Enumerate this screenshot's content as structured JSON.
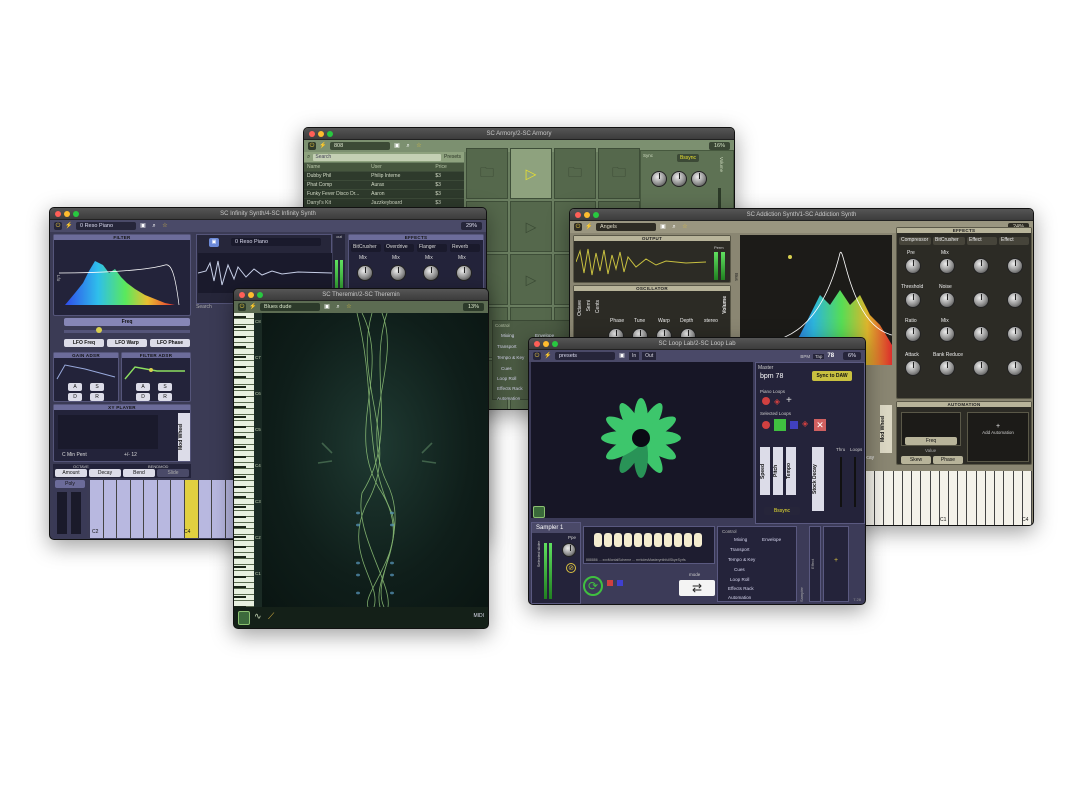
{
  "armory": {
    "title": "SC Armory/2-SC Armory",
    "preset": "808",
    "search_placeholder": "Search",
    "presets_label": "Presets",
    "percent": "16%",
    "columns": [
      "Name",
      "User",
      "Price"
    ],
    "rows": [
      {
        "name": "Dubby Phil",
        "user": "Philip Interne",
        "price": "$3"
      },
      {
        "name": "Phat Comp",
        "user": "Aurax",
        "price": "$3"
      },
      {
        "name": "Funky Fever Disco Dr...",
        "user": "Aaron",
        "price": "$3"
      },
      {
        "name": "Darryl's Kit",
        "user": "Jazzkeyboard",
        "price": "$3"
      }
    ],
    "menu_header": "Control",
    "menu": [
      "Mixing",
      "Envelope",
      "Transport",
      "Tempo & Key",
      "Cues",
      "Loop Roll",
      "Effects Rack",
      "Automation"
    ],
    "sync_label": "Bssync",
    "side_labels": [
      "Sync",
      "Volume",
      "Mode"
    ]
  },
  "infinity": {
    "title": "SC Infinity Synth/4-SC Infinity Synth",
    "preset": "0 Reso Piano",
    "preset2": "0 Reso Piano",
    "percent": "29%",
    "filter_label": "FILTER",
    "freq_label": "Freq",
    "lfo_buttons": [
      "LFO Freq",
      "LFO Warp",
      "LFO Phase"
    ],
    "gain_label": "GAIN ADSR",
    "filter_adsr_label": "FILTER ADSR",
    "adsr": [
      "A",
      "S",
      "D",
      "R"
    ],
    "xy_label": "XY PLAYER",
    "min_pent": "C Min Pent",
    "range": "+/- 12",
    "mod_wheel": "Mod Wheel",
    "effects_label": "EFFECTS",
    "effects": [
      "BitCrusher",
      "Overdrive",
      "Flanger",
      "Reverb"
    ],
    "mix": "Mix",
    "out": "out",
    "octave_label": "OCTAVE",
    "bendmod_label": "BENDMOD",
    "bottom_buttons": [
      "Amount",
      "Decay",
      "Bend",
      "Slide"
    ],
    "poly": "Poly",
    "key_labels": [
      "C2",
      "C3",
      "C4"
    ],
    "search": "Search",
    "side_label": "Lfo",
    "volume": "Volume"
  },
  "addiction": {
    "title": "SC Addiction Synth/1-SC Addiction Synth",
    "preset": "Angels",
    "percent": "24%",
    "output_label": "OUTPUT",
    "dots_label": "Perm",
    "oscillator_label": "OSCILLATOR",
    "osc_labels": [
      "Octave",
      "Semi",
      "Cents"
    ],
    "osc_knobs": [
      "Phase",
      "Tune",
      "Warp",
      "Depth"
    ],
    "stereo": "stereo",
    "volume": "Volume",
    "effects_label": "EFFECTS",
    "effect_slots": [
      "Compressor",
      "BitCrusher",
      "Effect",
      "Effect"
    ],
    "effect_knobs": [
      "Pre",
      "Mix",
      "Threshold",
      "Noise",
      "Ratio",
      "Mix",
      "Attack",
      "Bank Reduce"
    ],
    "automation_label": "AUTOMATION",
    "freq": "Freq",
    "value": "Value",
    "add_automation": "Add Automation",
    "skew": "Skew",
    "phase": "Phase",
    "mod_wheel": "Mod Wheel",
    "decay": "Decay",
    "key_labels": [
      "C1",
      "C3",
      "C4"
    ],
    "side_label": "Bus"
  },
  "theremin": {
    "title": "SC Theremin/2-SC Theremin",
    "preset": "Blues dude",
    "percent": "13%",
    "key_labels": [
      "C8",
      "C7",
      "C6",
      "C5",
      "C4",
      "C3",
      "C2",
      "C1"
    ],
    "bottom_icons": [
      "sine-wave-icon",
      "ramp-icon"
    ],
    "corner_badge": "MIDI"
  },
  "looplab": {
    "title": "SC Loop Lab/2-SC Loop Lab",
    "preset": "presets",
    "in": "In",
    "out": "Out",
    "bpm_label": "BPM",
    "bpm_value": "78",
    "tap": "Tap",
    "percent": "6%",
    "master": "Master",
    "bpm_display": "bpm 78",
    "sync_button": "Sync to DAW",
    "piano_loops": "Piano Loops",
    "selected_loops": "Selected Loops",
    "vertical_labels": [
      "Speed",
      "Pitch",
      "Tempo"
    ],
    "stock_decay": "Stock Decay",
    "thru": "Thru",
    "loops": "Loops",
    "bssync": "Bssync",
    "sampler": "Sampler 1",
    "ppe": "Ppe",
    "selected_slider": "Selected slider",
    "waveform_caption": "888886 ... xxxMontalScheme ... rrrrkdesMasterynthfullSkyeSyrfs",
    "mode": "mode",
    "menu_header": "Control",
    "menu": [
      "Mixing",
      "Envelope",
      "Transport",
      "Tempo & Key",
      "Cues",
      "Loop Roll",
      "Effects Rack",
      "Automation"
    ],
    "sampler_label": "Sampler",
    "effect_label": "Effect",
    "version": "7.28"
  }
}
